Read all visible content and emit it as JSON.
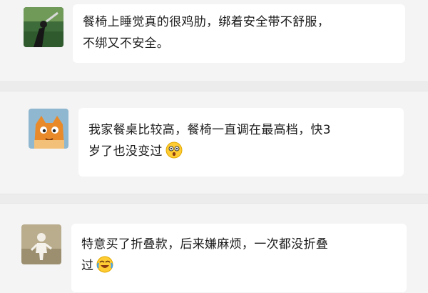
{
  "comments": [
    {
      "avatar_icon": "avatar-person-on-grass-icon",
      "lines": [
        "餐椅上睡觉真的很鸡肋，绑着安全带不舒服，",
        "不绑又不安全。"
      ],
      "emoji": ""
    },
    {
      "avatar_icon": "avatar-orange-cat-icon",
      "lines": [
        "我家餐桌比较高，餐椅一直调在最高档，快3",
        "岁了也没变过"
      ],
      "emoji": "shocked-face-emoji-icon"
    },
    {
      "avatar_icon": "avatar-small-figure-icon",
      "lines": [
        "特意买了折叠款，后来嫌麻烦，一次都没折叠",
        "过"
      ],
      "emoji": "crying-laughing-face-emoji-icon"
    }
  ]
}
